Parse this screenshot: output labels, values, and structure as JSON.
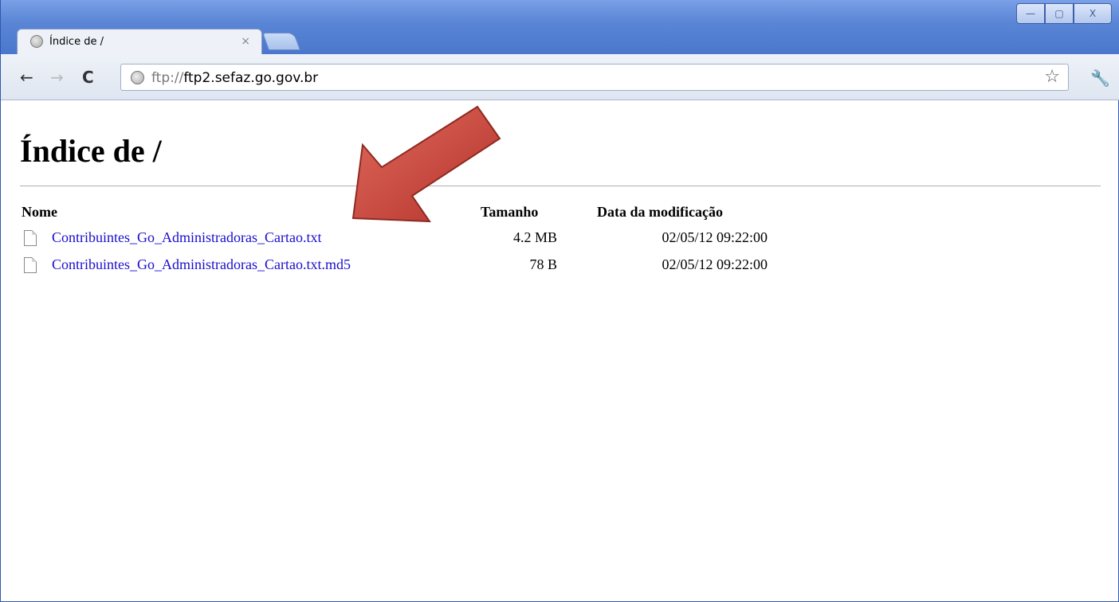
{
  "browser": {
    "tab": {
      "title": "Índice de /",
      "close_glyph": "×"
    },
    "window_controls": {
      "minimize": "—",
      "maximize": "▢",
      "close": "X"
    },
    "toolbar": {
      "url_scheme": "ftp://",
      "url_host": "ftp2.sefaz.go.gov.br"
    }
  },
  "page": {
    "heading": "Índice de /",
    "columns": {
      "name": "Nome",
      "size": "Tamanho",
      "date": "Data da modificação"
    },
    "files": [
      {
        "name": "Contribuintes_Go_Administradoras_Cartao.txt",
        "size": "4.2 MB",
        "date": "02/05/12 09:22:00"
      },
      {
        "name": "Contribuintes_Go_Administradoras_Cartao.txt.md5",
        "size": "78 B",
        "date": "02/05/12 09:22:00"
      }
    ]
  },
  "annotation": {
    "arrow_color": "#c0392b"
  }
}
